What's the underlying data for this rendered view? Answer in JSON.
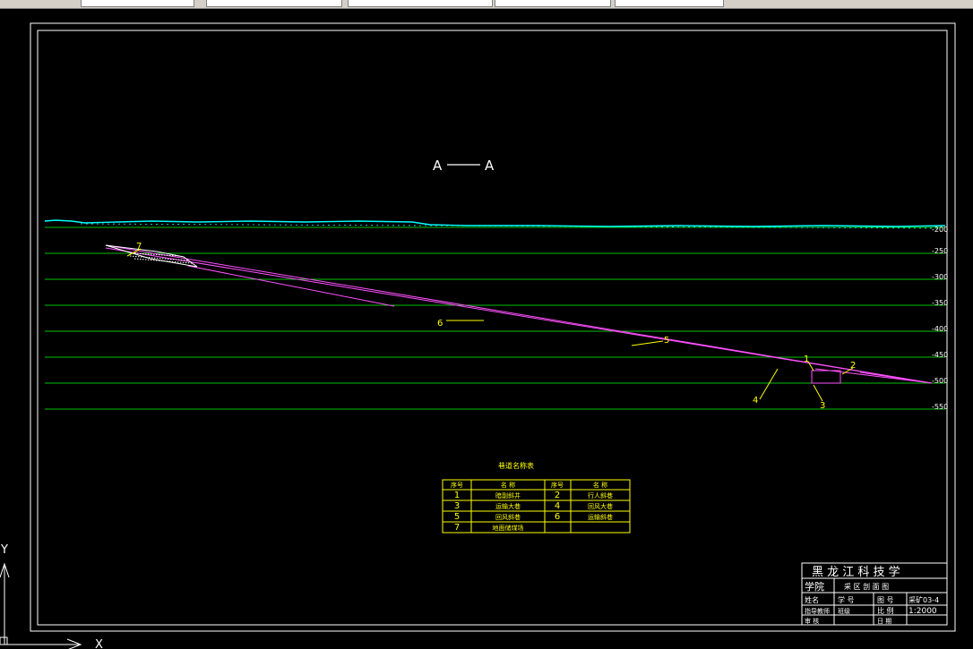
{
  "section_title": {
    "left": "A",
    "right": "A"
  },
  "elevation_labels": [
    "-200",
    "-250",
    "-300",
    "-350",
    "-400",
    "-450",
    "-500",
    "-550"
  ],
  "callouts": [
    "1",
    "2",
    "3",
    "4",
    "5",
    "6",
    "7"
  ],
  "legend_table": {
    "title": "巷道名称表",
    "headers": [
      "序号",
      "名 称",
      "序号",
      "名 称"
    ],
    "rows": [
      [
        "1",
        "暗副斜井",
        "2",
        "行人斜巷"
      ],
      [
        "3",
        "运输大巷",
        "4",
        "回风大巷"
      ],
      [
        "5",
        "回风斜巷",
        "6",
        "运输斜巷"
      ],
      [
        "7",
        "地面储煤场",
        "",
        ""
      ]
    ]
  },
  "title_block": {
    "school": "黑 龙 江 科 技 学",
    "row1_label": "学院",
    "row1_value": "采 区 剖 面 图",
    "row2": [
      "姓名",
      "学 号",
      "图 号",
      "采矿03-4"
    ],
    "row3": [
      "指导教师",
      "班级",
      "比 例",
      "1:2000"
    ],
    "row4": [
      "审 核",
      "",
      "日 期",
      ""
    ]
  },
  "ucs": {
    "y_label": "Y",
    "x_label": "X"
  },
  "colors": {
    "background": "#000000",
    "frame": "#ffffff",
    "grid": "#00c000",
    "surface": "#00ffff",
    "roadway": "#ff50ff",
    "callout": "#ffff00",
    "table": "#ffff00"
  }
}
